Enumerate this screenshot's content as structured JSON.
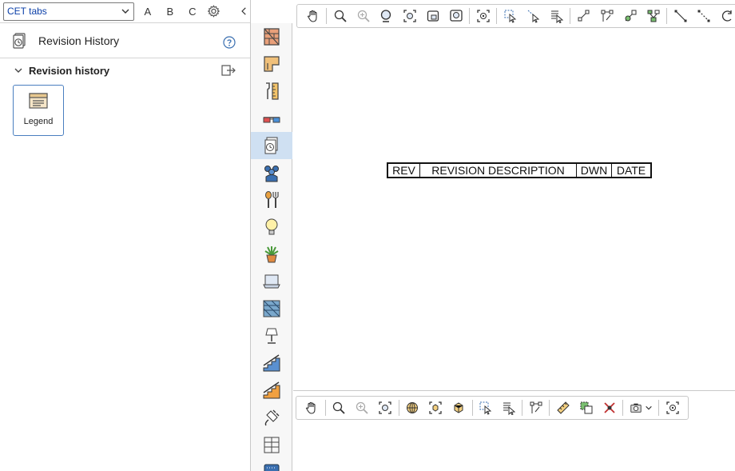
{
  "panel": {
    "tabs_select": {
      "value": "CET tabs"
    },
    "letters": [
      "A",
      "B",
      "C"
    ],
    "title": "Revision History",
    "section_title": "Revision history",
    "tile_label": "Legend"
  },
  "revision_block": {
    "columns": [
      "REV",
      "REVISION DESCRIPTION",
      "DWN",
      "DATE"
    ]
  },
  "vertical_toolbar": {
    "items": [
      {
        "icon": "wall-icon"
      },
      {
        "icon": "floor-plan-icon"
      },
      {
        "icon": "tools-icon"
      },
      {
        "icon": "3d-glasses-icon"
      },
      {
        "icon": "revision-history-icon",
        "active": true
      },
      {
        "icon": "people-icon"
      },
      {
        "icon": "kitchen-tools-icon"
      },
      {
        "icon": "lightbulb-icon"
      },
      {
        "icon": "plant-icon"
      },
      {
        "icon": "laptop-icon"
      },
      {
        "icon": "tiles-icon"
      },
      {
        "icon": "lamp-icon"
      },
      {
        "icon": "stairs-blue-icon"
      },
      {
        "icon": "stairs-orange-icon"
      },
      {
        "icon": "plug-icon"
      },
      {
        "icon": "shelving-icon"
      },
      {
        "icon": "calendar-icon"
      }
    ]
  },
  "colors": {
    "accent": "#0b3fa8",
    "active_bg": "#cfe0f2",
    "tile_border": "#4a7fc0"
  }
}
